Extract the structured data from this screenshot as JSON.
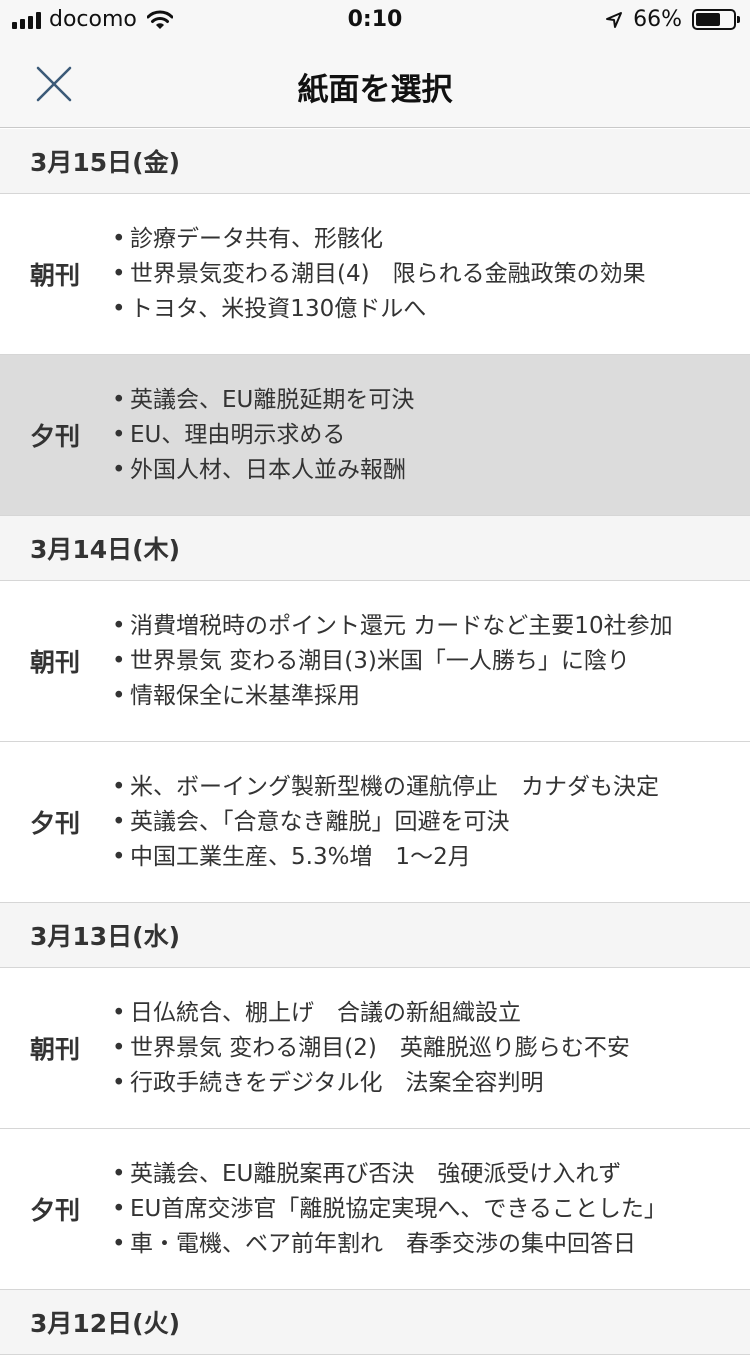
{
  "status_bar": {
    "carrier": "docomo",
    "time": "0:10",
    "battery": "66%",
    "battery_level": 0.66
  },
  "header": {
    "title": "紙面を選択",
    "close_icon": "close-icon"
  },
  "days": [
    {
      "date": "3月15日(金)",
      "editions": [
        {
          "label": "朝刊",
          "headlines": [
            "診療データ共有、形骸化",
            "世界景気変わる潮目(4)　限られる金融政策の効果",
            "トヨタ、米投資130億ドルへ"
          ]
        },
        {
          "label": "夕刊",
          "selected": true,
          "headlines": [
            "英議会、EU離脱延期を可決",
            "EU、理由明示求める",
            "外国人材、日本人並み報酬"
          ]
        }
      ]
    },
    {
      "date": "3月14日(木)",
      "editions": [
        {
          "label": "朝刊",
          "headlines": [
            "消費増税時のポイント還元 カードなど主要10社参加",
            "世界景気 変わる潮目(3)米国「一人勝ち」に陰り",
            "情報保全に米基準採用"
          ]
        },
        {
          "label": "夕刊",
          "headlines": [
            "米、ボーイング製新型機の運航停止　カナダも決定",
            "英議会、「合意なき離脱」回避を可決",
            "中国工業生産、5.3%増　1〜2月"
          ]
        }
      ]
    },
    {
      "date": "3月13日(水)",
      "editions": [
        {
          "label": "朝刊",
          "headlines": [
            "日仏統合、棚上げ　合議の新組織設立",
            "世界景気 変わる潮目(2)　英離脱巡り膨らむ不安",
            "行政手続きをデジタル化　法案全容判明"
          ]
        },
        {
          "label": "夕刊",
          "headlines": [
            "英議会、EU離脱案再び否決　強硬派受け入れず",
            "EU首席交渉官「離脱協定実現へ、できることした」",
            "車・電機、ベア前年割れ　春季交渉の集中回答日"
          ]
        }
      ]
    },
    {
      "date": "3月12日(火)",
      "editions": []
    }
  ]
}
